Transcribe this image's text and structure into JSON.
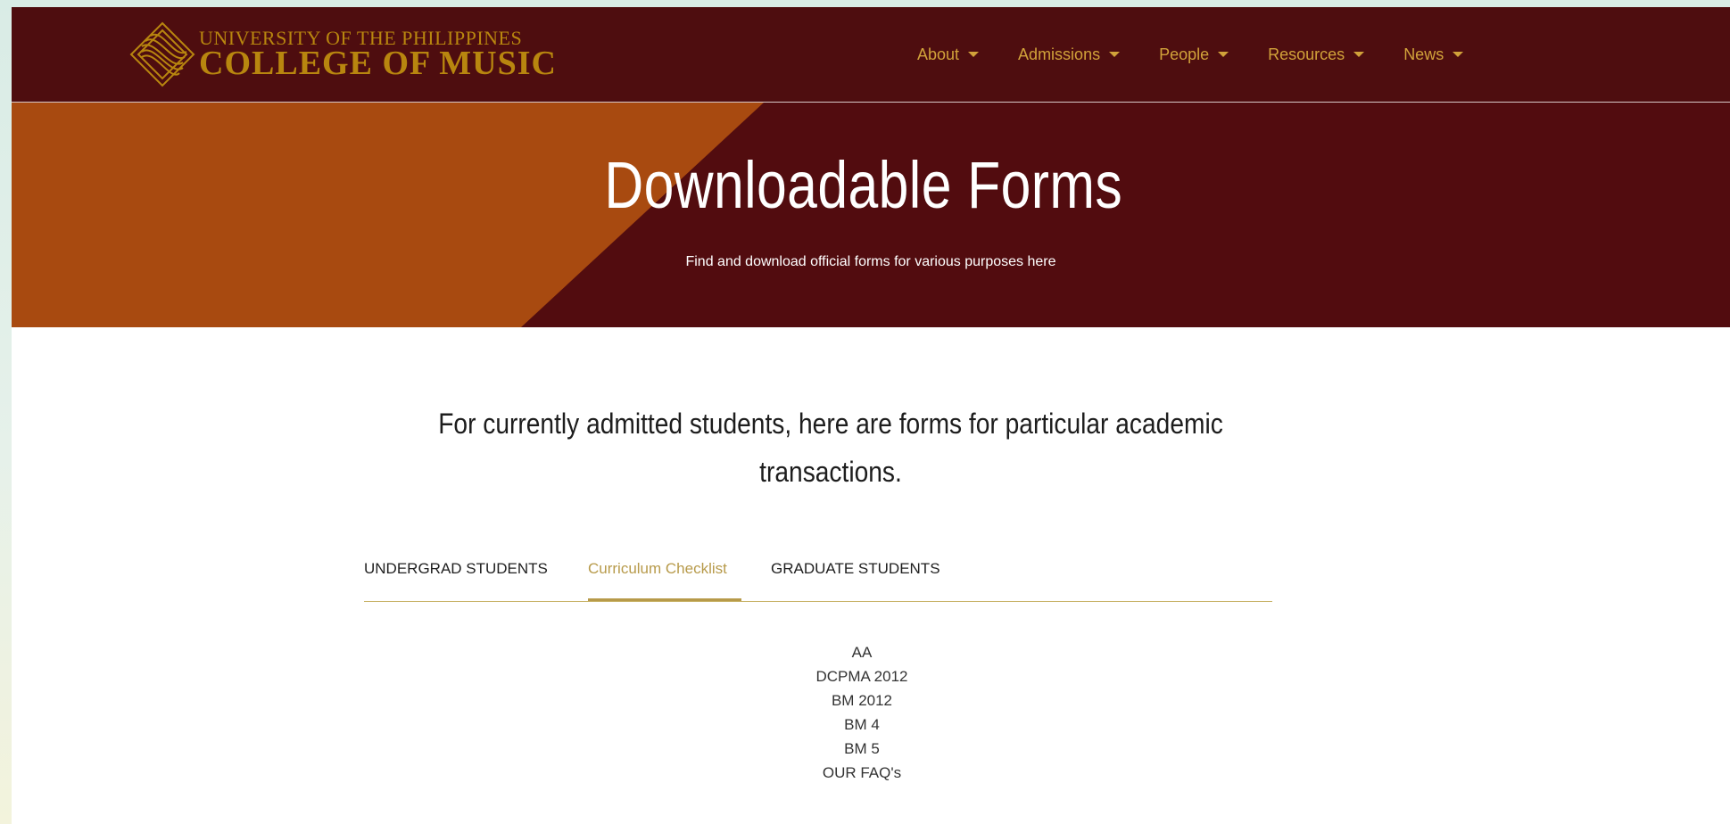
{
  "brand": {
    "line1": "UNIVERSITY OF THE PHILIPPINES",
    "line2": "COLLEGE OF MUSIC"
  },
  "nav": {
    "items": [
      {
        "label": "About"
      },
      {
        "label": "Admissions"
      },
      {
        "label": "People"
      },
      {
        "label": "Resources"
      },
      {
        "label": "News"
      }
    ]
  },
  "hero": {
    "title": "Downloadable Forms",
    "subtitle": "Find and download official forms for various purposes here"
  },
  "main": {
    "lead": "For currently admitted students, here are forms for particular academic transactions.",
    "tabs": [
      {
        "label": "UNDERGRAD STUDENTS",
        "active": false
      },
      {
        "label": "Curriculum Checklist",
        "active": true
      },
      {
        "label": "GRADUATE STUDENTS",
        "active": false
      }
    ],
    "links": [
      "AA",
      "DCPMA 2012",
      "BM 2012",
      "BM 4",
      "BM 5",
      "OUR FAQ's"
    ]
  },
  "colors": {
    "header_bg": "#4e0d0f",
    "hero_bg": "#520c0f",
    "hero_accent": "#a84a10",
    "gold": "#d1a23a",
    "tab_active": "#b79a4a"
  },
  "icons": [
    "college-logo-icon",
    "chevron-down-icon"
  ]
}
